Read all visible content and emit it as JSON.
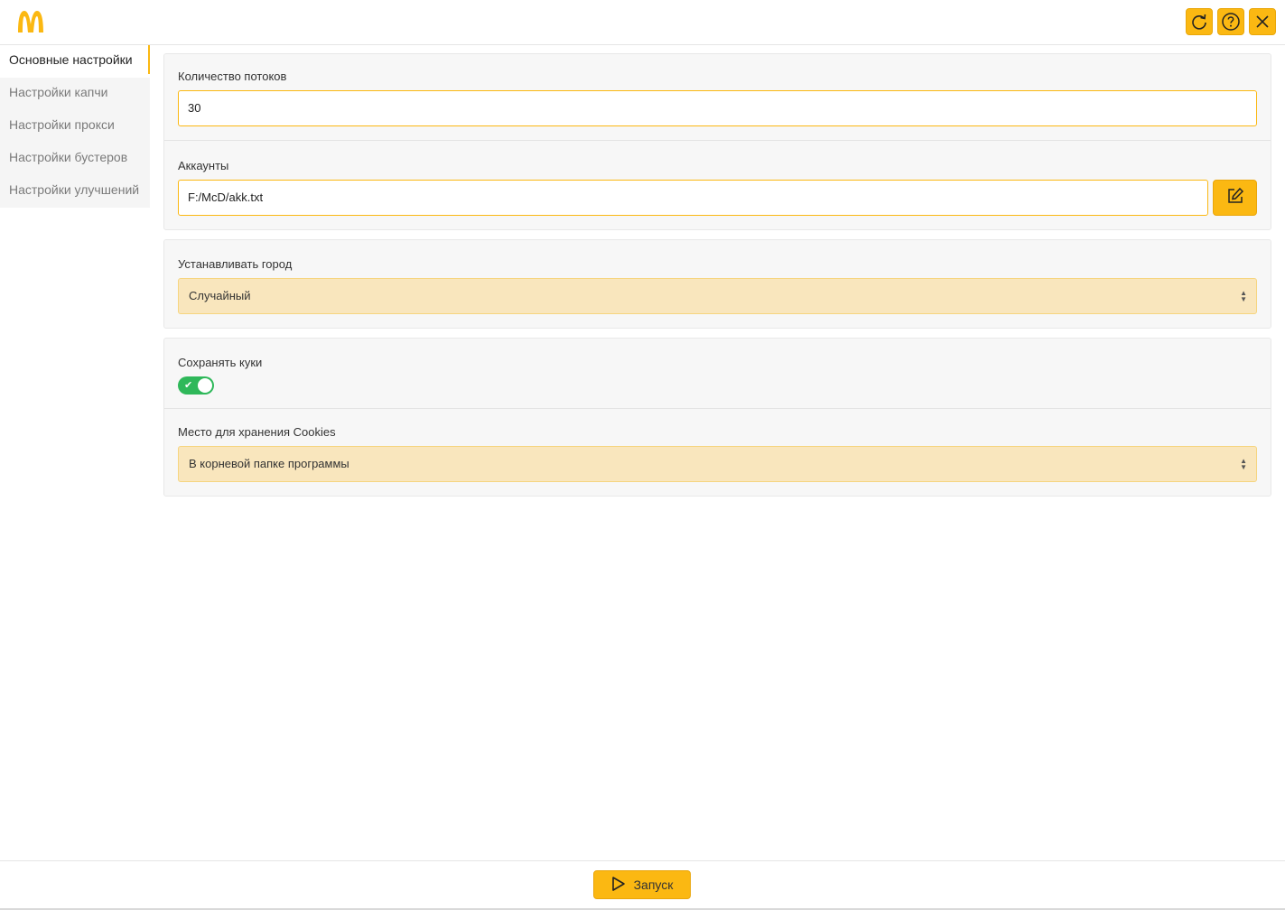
{
  "app": {
    "logo": "mcdonalds-m-logo",
    "accent_color": "#fbb812",
    "toolbar": {
      "refresh_icon": "refresh-icon",
      "help_icon": "help-icon",
      "close_icon": "close-icon"
    }
  },
  "sidebar": {
    "items": [
      {
        "label": "Основные настройки",
        "active": true
      },
      {
        "label": "Настройки капчи"
      },
      {
        "label": "Настройки прокси"
      },
      {
        "label": "Настройки бустеров"
      },
      {
        "label": "Настройки улучшений"
      }
    ]
  },
  "main": {
    "threads": {
      "label": "Количество потоков",
      "value": "30"
    },
    "accounts": {
      "label": "Аккаунты",
      "value": "F:/McD/akk.txt",
      "edit_icon": "edit-icon"
    },
    "city": {
      "label": "Устанавливать город",
      "value": "Случайный"
    },
    "cookies": {
      "save_label": "Сохранять куки",
      "save_enabled": true,
      "toggle_color": "#2fb85a",
      "storage_label": "Место для хранения Cookies",
      "storage_value": "В корневой папке программы"
    }
  },
  "footer": {
    "run_label": "Запуск",
    "run_icon": "play-icon"
  }
}
